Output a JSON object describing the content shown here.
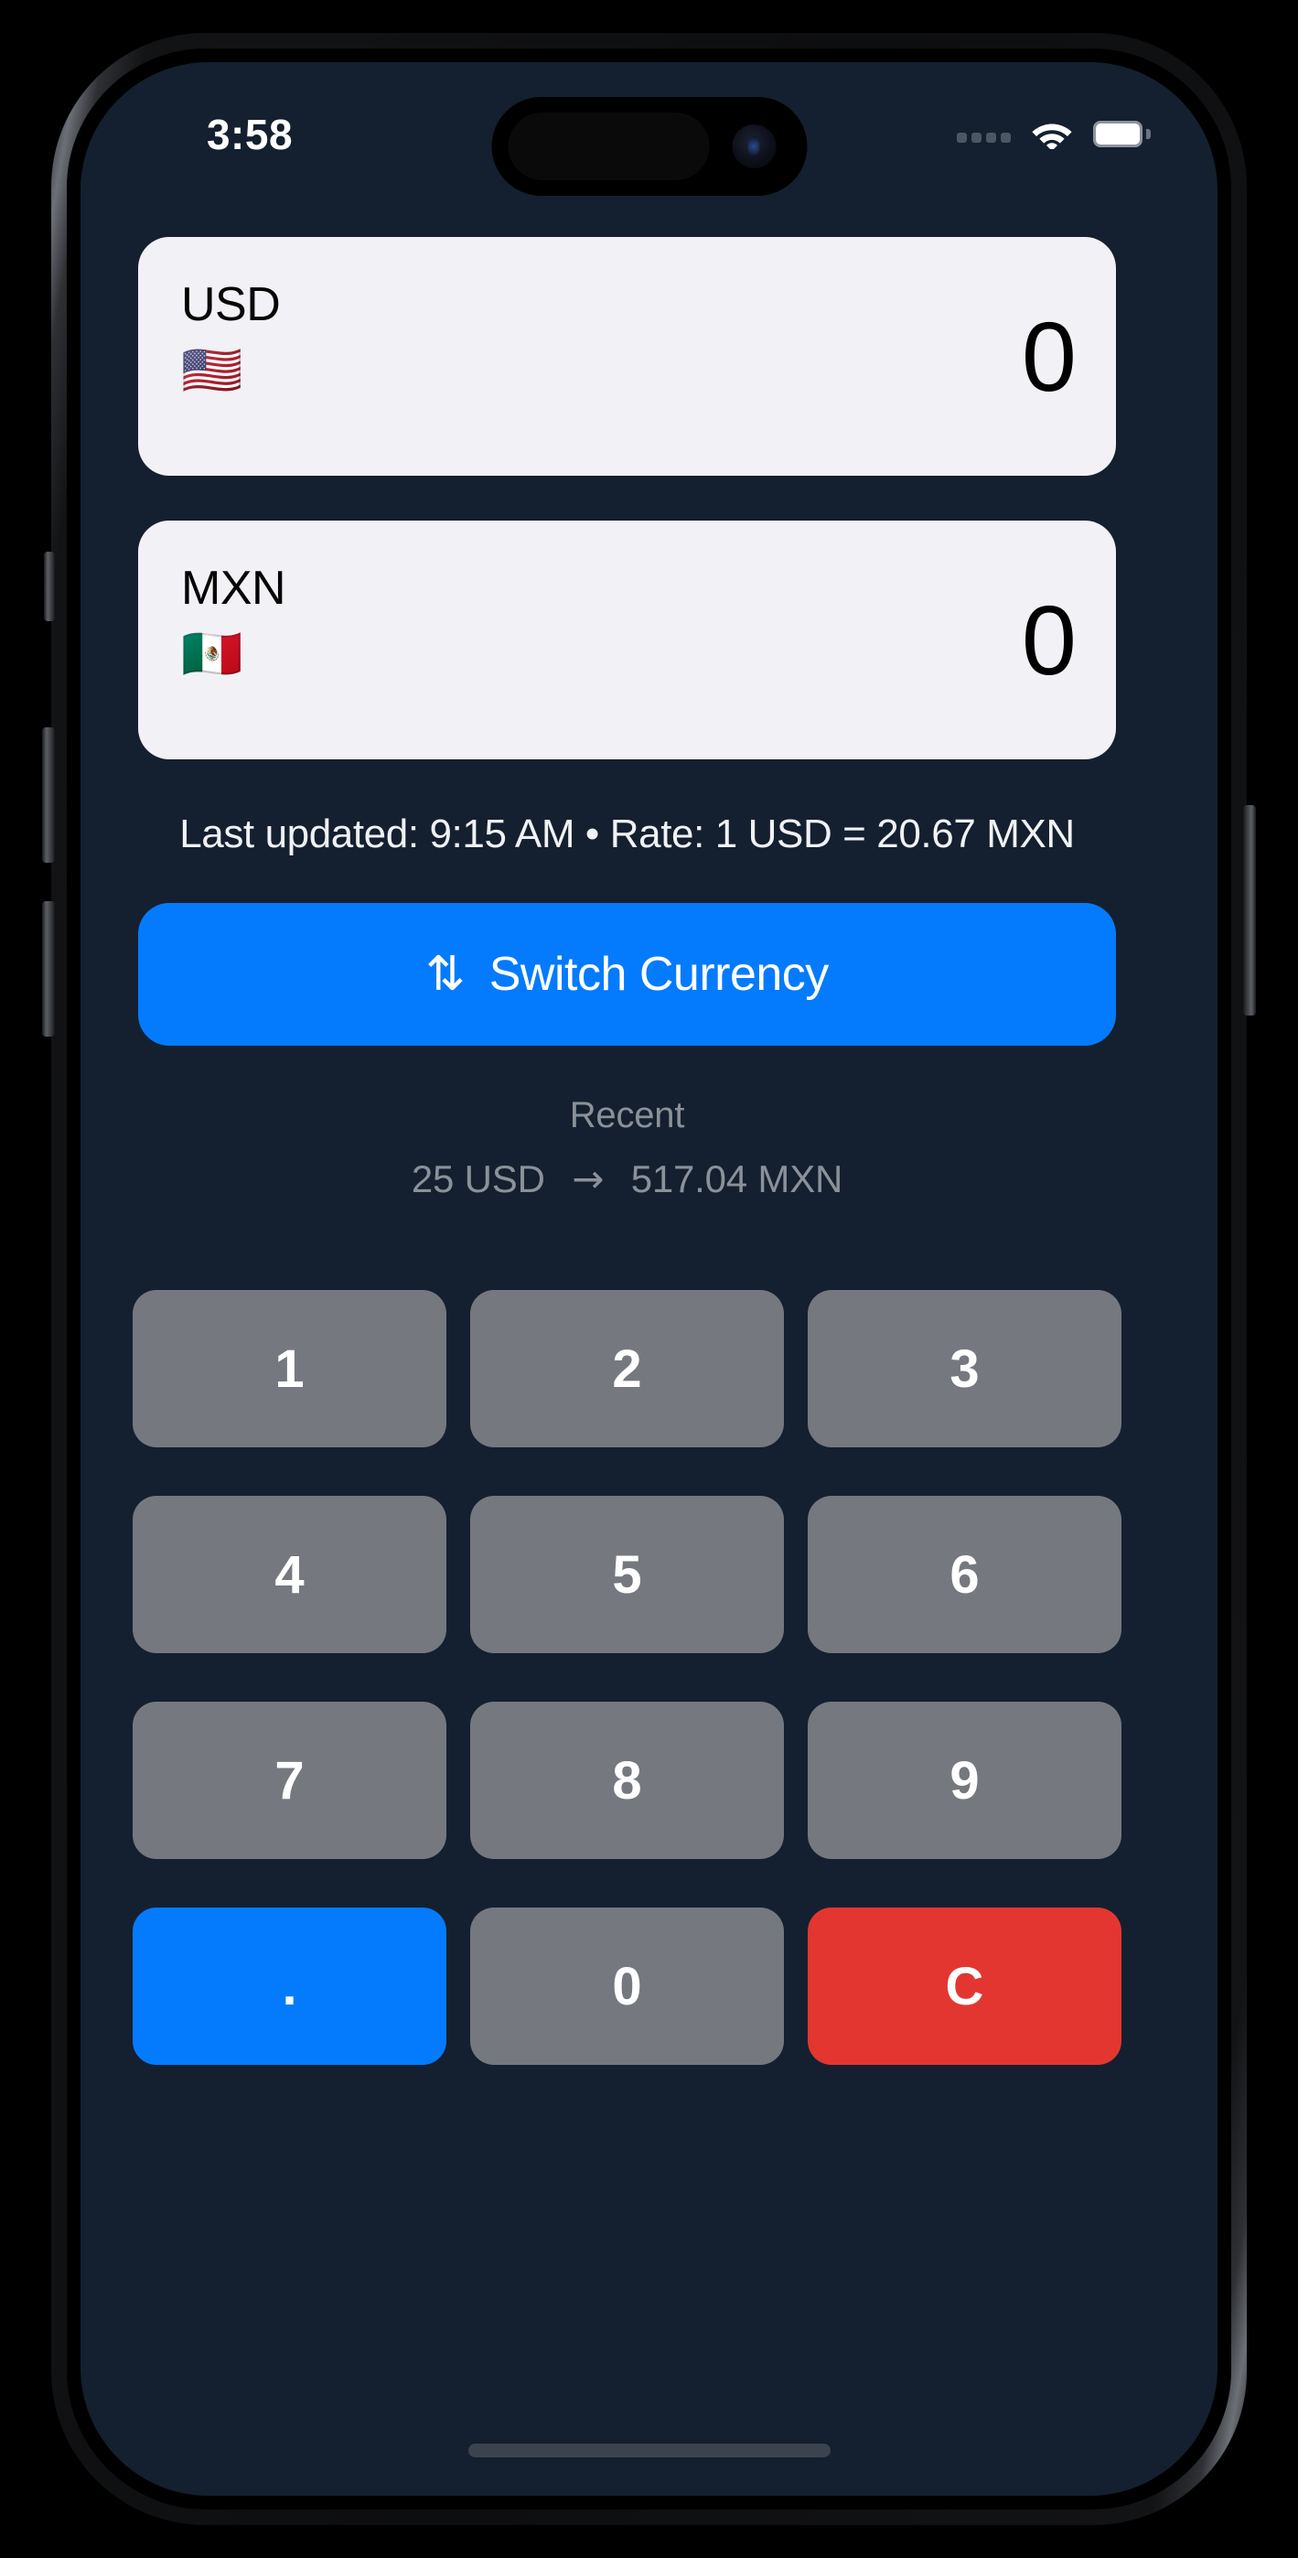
{
  "status_bar": {
    "time": "3:58",
    "signal_icon": "signal-dots-icon",
    "wifi_icon": "wifi-icon",
    "battery_icon": "battery-full-icon"
  },
  "cards": [
    {
      "code": "USD",
      "flag": "🇺🇸",
      "flag_name": "flag-united-states",
      "amount": "0"
    },
    {
      "code": "MXN",
      "flag": "🇲🇽",
      "flag_name": "flag-mexico",
      "amount": "0"
    }
  ],
  "rate_info": {
    "text": "Last updated: 9:15 AM • Rate: 1 USD = 20.67 MXN",
    "last_updated_label": "Last updated:",
    "last_updated_time": "9:15 AM",
    "rate_label": "Rate:",
    "rate_value": "1 USD = 20.67 MXN"
  },
  "switch_button": {
    "icon": "⇅",
    "icon_name": "switch-arrows-icon",
    "label": "Switch Currency"
  },
  "recent": {
    "title": "Recent",
    "from": "25 USD",
    "arrow": "→",
    "to": "517.04 MXN"
  },
  "keypad": [
    {
      "label": "1",
      "name": "key-1",
      "style": "default"
    },
    {
      "label": "2",
      "name": "key-2",
      "style": "default"
    },
    {
      "label": "3",
      "name": "key-3",
      "style": "default"
    },
    {
      "label": "4",
      "name": "key-4",
      "style": "default"
    },
    {
      "label": "5",
      "name": "key-5",
      "style": "default"
    },
    {
      "label": "6",
      "name": "key-6",
      "style": "default"
    },
    {
      "label": "7",
      "name": "key-7",
      "style": "default"
    },
    {
      "label": "8",
      "name": "key-8",
      "style": "default"
    },
    {
      "label": "9",
      "name": "key-9",
      "style": "default"
    },
    {
      "label": ".",
      "name": "key-decimal",
      "style": "accent"
    },
    {
      "label": "0",
      "name": "key-0",
      "style": "default"
    },
    {
      "label": "C",
      "name": "key-clear",
      "style": "danger"
    }
  ],
  "colors": {
    "screen_background": "#14202f",
    "card_background": "#f1f1f6",
    "accent_blue": "#047bfd",
    "danger_red": "#e43630",
    "key_gray": "#75787f",
    "muted_text": "#8b9199"
  }
}
